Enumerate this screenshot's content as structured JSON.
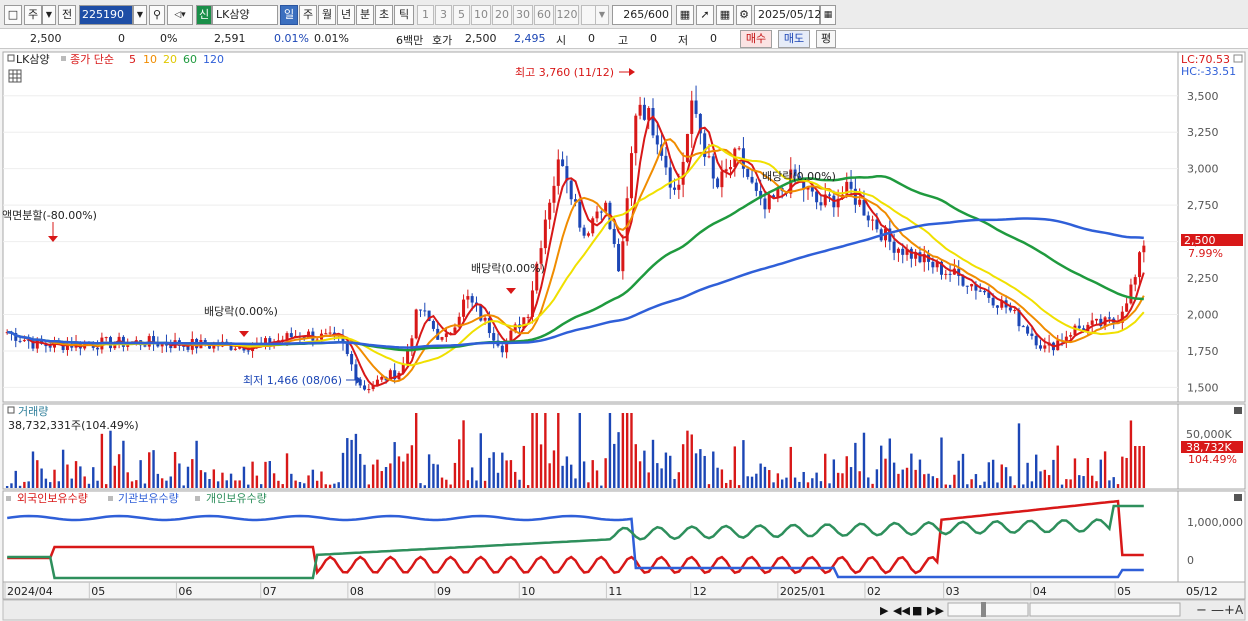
{
  "toolbar": {
    "market": "주",
    "jeon": "전",
    "code": "225190",
    "sin": "신",
    "stock_name": "LK삼양",
    "periods": [
      "일",
      "주",
      "월",
      "년",
      "분",
      "초",
      "틱"
    ],
    "intervals": [
      "1",
      "3",
      "5",
      "10",
      "20",
      "30",
      "60",
      "120"
    ],
    "count": "265",
    "total": "/600",
    "date": "2025/05/12"
  },
  "quote": {
    "price": "2,500",
    "change": "0",
    "change_pct": "0%",
    "prev": "2,591",
    "rate1": "0.01%",
    "rate2": "0.01%",
    "volume_label": "6백만",
    "hoga_label": "호가",
    "hoga_sell": "2,500",
    "hoga_buy": "2,495",
    "open_label": "시",
    "open_val": "0",
    "high_label": "고",
    "high_val": "0",
    "low_label": "저",
    "low_val": "0",
    "buy_btn": "매수",
    "sell_btn": "매도",
    "eval_btn": "평"
  },
  "chart_data": [
    {
      "type": "candlestick",
      "title_tag": "LK삼양",
      "legend_prefix": "종가 단순",
      "ma_labels": [
        "5",
        "10",
        "20",
        "60",
        "120"
      ],
      "ma_colors": [
        "#d81818",
        "#f08c00",
        "#f0e000",
        "#1f9a3e",
        "#2f5fd8"
      ],
      "ylim": [
        1400,
        3800
      ],
      "y_ticks": [
        "3,500",
        "3,250",
        "3,000",
        "2,750",
        "2,500",
        "2,250",
        "2,000",
        "1,750",
        "1,500"
      ],
      "y_tick_values": [
        3500,
        3250,
        3000,
        2750,
        2500,
        2250,
        2000,
        1750,
        1500
      ],
      "lc": "LC:70.53",
      "hc": "HC:-33.51",
      "last_price": "2,500",
      "last_pct": "7.99%",
      "annotations": {
        "split": "액면분할(-80.00%)",
        "div1": "배당락(0.00%)",
        "div2": "배당락(0.00%)",
        "div3": "배당락(0.00%)",
        "high": "최고 3,760 (11/12)",
        "low": "최저 1,466 (08/06)"
      },
      "close_points": [
        [
          "2024-04-01",
          1880
        ],
        [
          "2024-04-12",
          1790
        ],
        [
          "2024-05-01",
          1800
        ],
        [
          "2024-05-20",
          1810
        ],
        [
          "2024-06-10",
          1790
        ],
        [
          "2024-07-01",
          1790
        ],
        [
          "2024-07-15",
          1870
        ],
        [
          "2024-07-29",
          1820
        ],
        [
          "2024-08-06",
          1490
        ],
        [
          "2024-08-20",
          1620
        ],
        [
          "2024-08-26",
          2050
        ],
        [
          "2024-09-04",
          1800
        ],
        [
          "2024-09-12",
          2120
        ],
        [
          "2024-09-25",
          1780
        ],
        [
          "2024-10-04",
          2020
        ],
        [
          "2024-10-11",
          2750
        ],
        [
          "2024-10-16",
          3100
        ],
        [
          "2024-10-24",
          2550
        ],
        [
          "2024-10-31",
          2800
        ],
        [
          "2024-11-06",
          2260
        ],
        [
          "2024-11-12",
          3500
        ],
        [
          "2024-11-19",
          3250
        ],
        [
          "2024-11-26",
          2800
        ],
        [
          "2024-12-02",
          3450
        ],
        [
          "2024-12-10",
          2850
        ],
        [
          "2024-12-18",
          3100
        ],
        [
          "2024-12-27",
          2700
        ],
        [
          "2025-01-07",
          2950
        ],
        [
          "2025-01-16",
          2750
        ],
        [
          "2025-01-27",
          2850
        ],
        [
          "2025-02-10",
          2500
        ],
        [
          "2025-02-24",
          2350
        ],
        [
          "2025-03-10",
          2230
        ],
        [
          "2025-03-24",
          2050
        ],
        [
          "2025-04-07",
          1760
        ],
        [
          "2025-04-17",
          1900
        ],
        [
          "2025-05-02",
          1950
        ],
        [
          "2025-05-09",
          2250
        ],
        [
          "2025-05-12",
          2500
        ]
      ]
    },
    {
      "type": "bar",
      "title": "거래량",
      "value_label": "38,732,331주(104.49%)",
      "y_ticks": [
        "50,000K"
      ],
      "last_value": "38,732K",
      "last_pct": "104.49%"
    },
    {
      "type": "line",
      "series": [
        {
          "name": "외국인보유수량",
          "color": "#d81818"
        },
        {
          "name": "기관보유수량",
          "color": "#2f5fd8"
        },
        {
          "name": "개인보유수량",
          "color": "#2e8f5c"
        }
      ],
      "y_ticks": [
        "1,000,000",
        "0"
      ]
    }
  ],
  "x_axis": {
    "labels": [
      "2024/04",
      "05",
      "06",
      "07",
      "08",
      "09",
      "10",
      "11",
      "12",
      "2025/01",
      "02",
      "03",
      "04",
      "05"
    ],
    "right_label": "05/12"
  }
}
